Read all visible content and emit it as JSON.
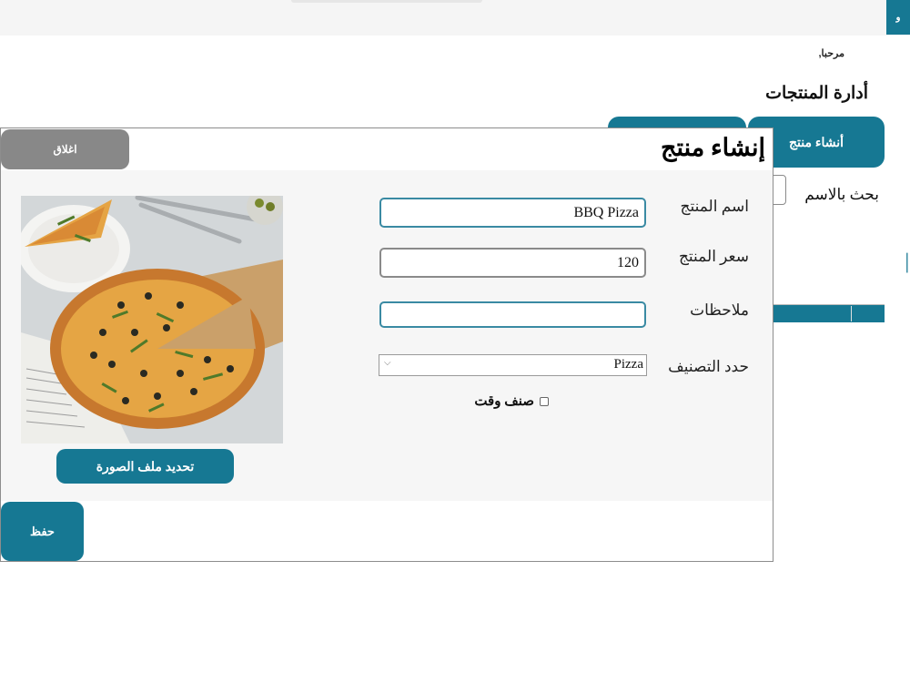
{
  "topbar": {
    "button_label": "و"
  },
  "header": {
    "welcome": "مرحبا,",
    "page_title": "أدارة المنتجات"
  },
  "tabs": [
    {
      "label": "أنشاء منتج"
    },
    {
      "label": ""
    }
  ],
  "background": {
    "search_label": "بحث بالاسم"
  },
  "modal": {
    "title": "إنشاء منتج",
    "close_label": "اغلاق",
    "fields": {
      "name_label": "اسم المنتج",
      "name_value": "BBQ Pizza",
      "price_label": "سعر المنتج",
      "price_value": "120",
      "notes_label": "ملاحظات",
      "notes_value": "",
      "category_label": "حدد التصنيف",
      "category_value": "Pizza",
      "temp_item_label": "صنف وقت",
      "temp_item_checked": false
    },
    "upload_label": "تحديد ملف الصورة",
    "save_label": "حفظ"
  },
  "colors": {
    "accent": "#167893",
    "close_button": "#888888",
    "body_bg": "#f6f6f6",
    "input_border": "#3a8aa3"
  }
}
